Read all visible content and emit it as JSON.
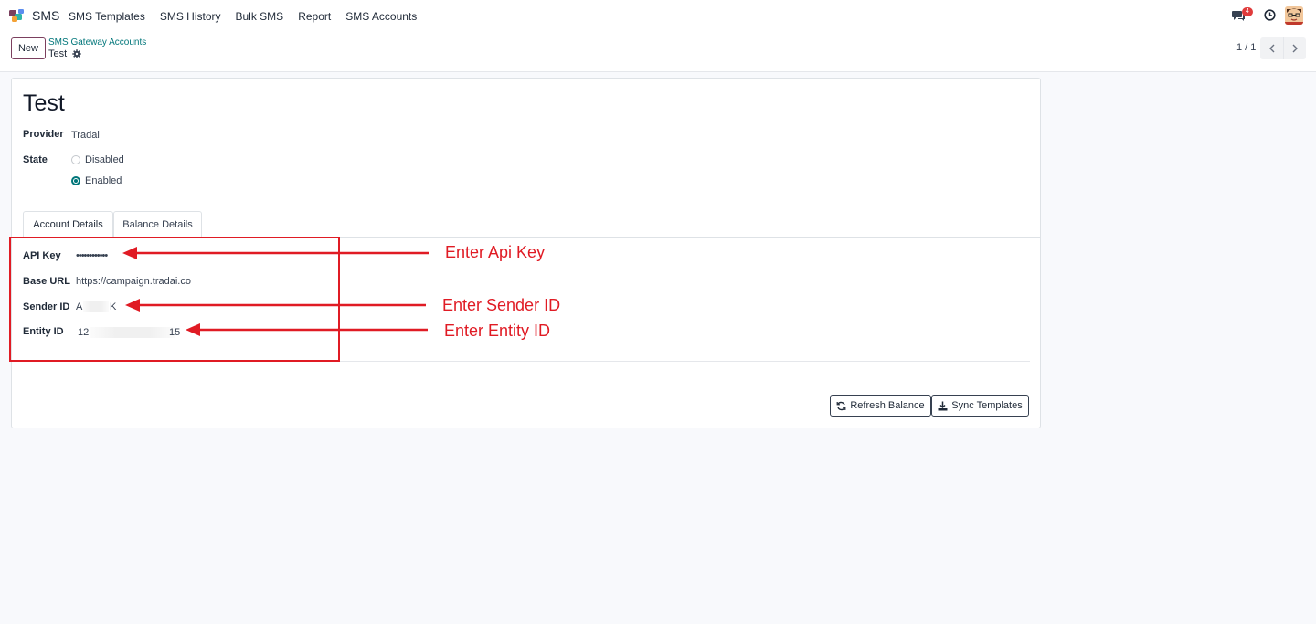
{
  "navbar": {
    "app_name": "SMS",
    "menu": [
      "SMS Templates",
      "SMS History",
      "Bulk SMS",
      "Report",
      "SMS Accounts"
    ],
    "chat_badge": "4"
  },
  "control_panel": {
    "new_label": "New",
    "breadcrumb_parent": "SMS Gateway Accounts",
    "breadcrumb_current": "Test",
    "pager": "1 / 1"
  },
  "record": {
    "title": "Test",
    "provider_label": "Provider",
    "provider_value": "Tradai",
    "state_label": "State",
    "state_options": [
      "Disabled",
      "Enabled"
    ],
    "state_selected": "Enabled",
    "tabs": [
      "Account Details",
      "Balance Details"
    ],
    "active_tab": "Account Details",
    "fields": {
      "api_key_label": "API Key",
      "api_key_value": "••••••••••••",
      "base_url_label": "Base URL",
      "base_url_value": "https://campaign.tradai.co",
      "sender_id_label": "Sender ID",
      "sender_id_start": "A",
      "sender_id_end": "K",
      "entity_id_label": "Entity ID",
      "entity_id_start": "12",
      "entity_id_end": "15"
    },
    "buttons": {
      "refresh_balance": "Refresh Balance",
      "sync_templates": "Sync Templates"
    }
  },
  "annotations": {
    "api_key": "Enter Api Key",
    "sender_id": "Enter Sender ID",
    "entity_id": "Enter Entity ID",
    "color": "#e01b24"
  },
  "colors": {
    "brand": "#7b3f5e",
    "accent": "#01767a",
    "background": "#f8f9fc"
  }
}
